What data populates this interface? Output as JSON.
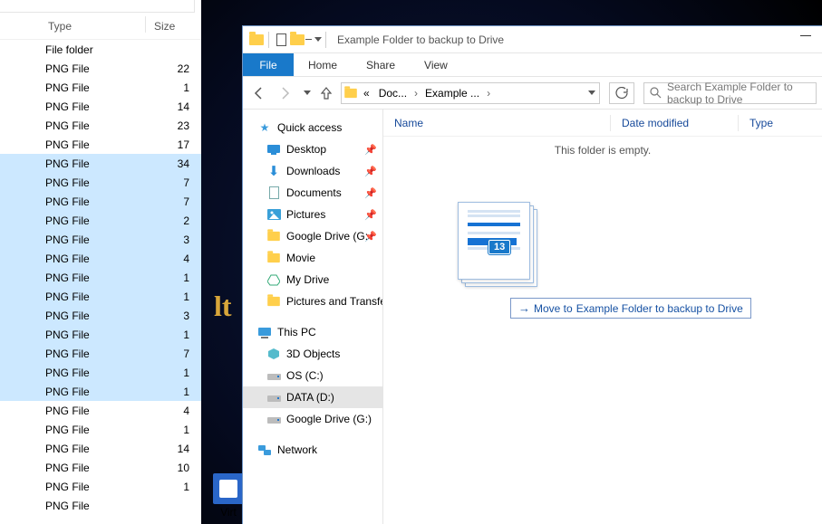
{
  "left_panel": {
    "header_type": "Type",
    "header_size": "Size",
    "rows": [
      {
        "type": "File folder",
        "size": "",
        "sel": false
      },
      {
        "type": "PNG File",
        "size": "22",
        "sel": false
      },
      {
        "type": "PNG File",
        "size": "1",
        "sel": false
      },
      {
        "type": "PNG File",
        "size": "14",
        "sel": false
      },
      {
        "type": "PNG File",
        "size": "23",
        "sel": false
      },
      {
        "type": "PNG File",
        "size": "17",
        "sel": false
      },
      {
        "type": "PNG File",
        "size": "34",
        "sel": true
      },
      {
        "type": "PNG File",
        "size": "7",
        "sel": true
      },
      {
        "type": "PNG File",
        "size": "7",
        "sel": true
      },
      {
        "type": "PNG File",
        "size": "2",
        "sel": true
      },
      {
        "type": "PNG File",
        "size": "3",
        "sel": true
      },
      {
        "type": "PNG File",
        "size": "4",
        "sel": true
      },
      {
        "type": "PNG File",
        "size": "1",
        "sel": true
      },
      {
        "type": "PNG File",
        "size": "1",
        "sel": true
      },
      {
        "type": "PNG File",
        "size": "3",
        "sel": true
      },
      {
        "type": "PNG File",
        "size": "1",
        "sel": true
      },
      {
        "type": "PNG File",
        "size": "7",
        "sel": true
      },
      {
        "type": "PNG File",
        "size": "1",
        "sel": true
      },
      {
        "type": "PNG File",
        "size": "1",
        "sel": true
      },
      {
        "type": "PNG File",
        "size": "4",
        "sel": false
      },
      {
        "type": "PNG File",
        "size": "1",
        "sel": false
      },
      {
        "type": "PNG File",
        "size": "14",
        "sel": false
      },
      {
        "type": "PNG File",
        "size": "10",
        "sel": false
      },
      {
        "type": "PNG File",
        "size": "1",
        "sel": false
      },
      {
        "type": "PNG File",
        "size": "",
        "sel": false
      }
    ]
  },
  "desktop": {
    "lt_text": "lt",
    "icon_label": "Virt"
  },
  "explorer": {
    "title": "Example Folder to backup to Drive",
    "ribbon": {
      "file": "File",
      "home": "Home",
      "share": "Share",
      "view": "View"
    },
    "address": {
      "prefix": "«",
      "seg1": "Doc...",
      "seg2": "Example ..."
    },
    "search_placeholder": "Search Example Folder to backup to Drive",
    "columns": {
      "name": "Name",
      "date": "Date modified",
      "type": "Type"
    },
    "empty_text": "This folder is empty.",
    "tree": {
      "quick_access": "Quick access",
      "desktop": "Desktop",
      "downloads": "Downloads",
      "documents": "Documents",
      "pictures": "Pictures",
      "gdrive_g": "Google Drive (G:",
      "movie": "Movie",
      "mydrive": "My Drive",
      "pics_trans": "Pictures and Transfe",
      "this_pc": "This PC",
      "obj3d": "3D Objects",
      "os_c": "OS (C:)",
      "data_d": "DATA (D:)",
      "gdrive_g2": "Google Drive (G:)",
      "network": "Network"
    },
    "drag": {
      "count": "13",
      "tooltip_pre": "Move to ",
      "tooltip_target": "Example Folder to backup to Drive"
    }
  }
}
